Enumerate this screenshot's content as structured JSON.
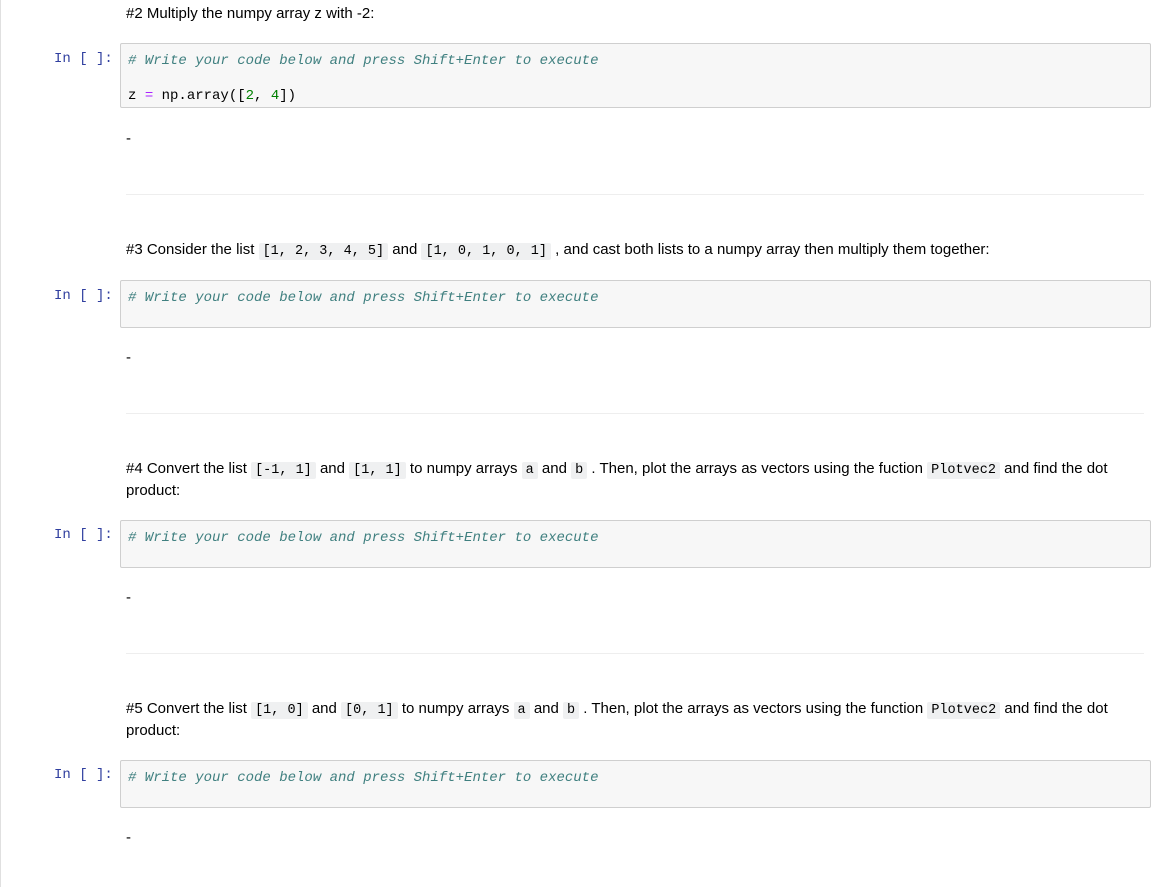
{
  "cells": {
    "q2": {
      "text": "#2 Multiply the numpy array z with -2:",
      "prompt": "In [ ]:",
      "comment": "# Write your code below and press Shift+Enter to execute",
      "code": {
        "var": "z",
        "op": "=",
        "call": " np.array([",
        "n1": "2",
        "sep": ", ",
        "n2": "4",
        "close": "])"
      },
      "output": "-"
    },
    "q3": {
      "t1": "#3 Consider the list ",
      "c1": "[1, 2, 3, 4, 5]",
      "t2": " and ",
      "c2": "[1, 0, 1, 0, 1]",
      "t3": " , and cast both lists to a numpy array then multiply them together:",
      "prompt": "In [ ]:",
      "comment": "# Write your code below and press Shift+Enter to execute",
      "output": "-"
    },
    "q4": {
      "t1": "#4 Convert the list ",
      "c1": "[-1, 1]",
      "t2": " and ",
      "c2": "[1, 1]",
      "t3": " to numpy arrays ",
      "c3": "a",
      "t4": " and ",
      "c4": "b",
      "t5": " . Then, plot the arrays as vectors using the fuction ",
      "c5": "Plotvec2",
      "t6": " and find the dot product:",
      "prompt": "In [ ]:",
      "comment": "# Write your code below and press Shift+Enter to execute",
      "output": "-"
    },
    "q5": {
      "t1": "#5 Convert the list ",
      "c1": "[1, 0]",
      "t2": " and ",
      "c2": "[0, 1]",
      "t3": " to numpy arrays ",
      "c3": "a",
      "t4": " and ",
      "c4": "b",
      "t5": " . Then, plot the arrays as vectors using the function ",
      "c5": "Plotvec2",
      "t6": " and find the dot product:",
      "prompt": "In [ ]:",
      "comment": "# Write your code below and press Shift+Enter to execute",
      "output": "-"
    }
  }
}
